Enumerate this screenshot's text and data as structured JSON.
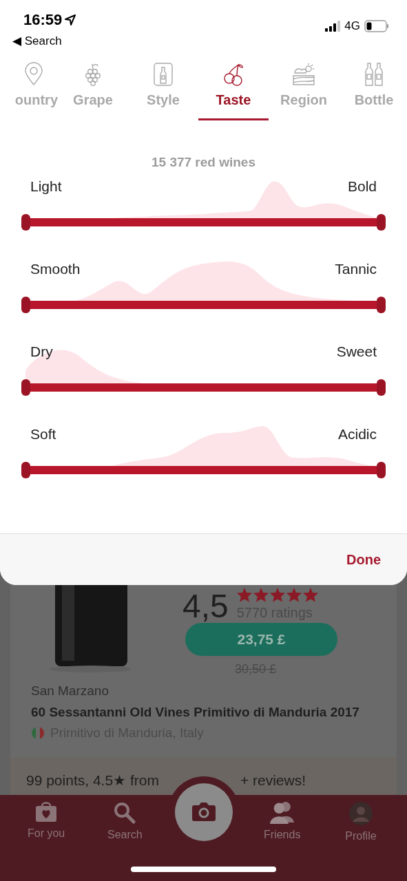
{
  "status_bar": {
    "time": "16:59",
    "back": "◀ Search",
    "network": "4G"
  },
  "filter_tabs": [
    {
      "label": "ountry",
      "selected": false
    },
    {
      "label": "Grape",
      "selected": false
    },
    {
      "label": "Style",
      "selected": false
    },
    {
      "label": "Taste",
      "selected": true
    },
    {
      "label": "Region",
      "selected": false
    },
    {
      "label": "Bottle",
      "selected": false
    }
  ],
  "taste": {
    "count": "15 377 red wines",
    "sliders": [
      {
        "left": "Light",
        "right": "Bold"
      },
      {
        "left": "Smooth",
        "right": "Tannic"
      },
      {
        "left": "Dry",
        "right": "Sweet"
      },
      {
        "left": "Soft",
        "right": "Acidic"
      }
    ]
  },
  "done": "Done",
  "wine": {
    "rating": "4,5",
    "stars": 5,
    "ratings": "5770 ratings",
    "price": "23,75 £",
    "old_price": "30,50 £",
    "winery": "San Marzano",
    "name": "60 Sessantanni Old Vines Primitivo di Manduria 2017",
    "region": "Primitivo di Manduria, Italy",
    "banner_start": "99 points, 4.5★ from",
    "banner_end": "+ reviews!"
  },
  "bottom_nav": [
    {
      "kind": "tab",
      "label": "For you"
    },
    {
      "kind": "tab",
      "label": "Search"
    },
    {
      "kind": "camera"
    },
    {
      "kind": "tab",
      "label": "Friends"
    },
    {
      "kind": "tab",
      "label": "Profile"
    }
  ]
}
